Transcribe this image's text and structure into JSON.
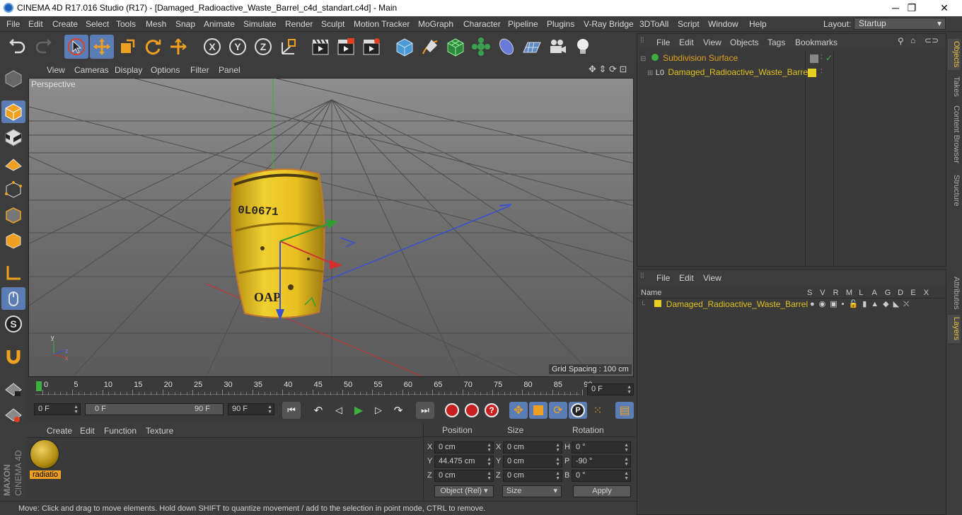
{
  "window": {
    "title": "CINEMA 4D R17.016 Studio (R17) - [Damaged_Radioactive_Waste_Barrel_c4d_standart.c4d] - Main",
    "minimize": "─",
    "maximize": "❐",
    "close": "✕"
  },
  "menubar": {
    "items": [
      "File",
      "Edit",
      "Create",
      "Select",
      "Tools",
      "Mesh",
      "Snap",
      "Animate",
      "Simulate",
      "Render",
      "Sculpt",
      "Motion Tracker",
      "MoGraph",
      "Character",
      "Pipeline",
      "Plugins",
      "V-Ray Bridge",
      "3DToAll",
      "Script",
      "Window",
      "Help"
    ],
    "layout_label": "Layout:",
    "layout_value": "Startup"
  },
  "viewport": {
    "menu": [
      "View",
      "Cameras",
      "Display",
      "Options",
      "Filter",
      "Panel"
    ],
    "name": "Perspective",
    "grid_spacing": "Grid Spacing : 100 cm",
    "barrel_text_top": "0L0671",
    "barrel_text_bottom": "OAP",
    "axis_x": "x",
    "axis_y": "y",
    "axis_z": "z"
  },
  "timeline": {
    "ticks": [
      "0",
      "5",
      "10",
      "15",
      "20",
      "25",
      "30",
      "35",
      "40",
      "45",
      "50",
      "55",
      "60",
      "65",
      "70",
      "75",
      "80",
      "85",
      "90"
    ],
    "current_frame": "0 F"
  },
  "transport": {
    "start": "0 F",
    "range_start": "0 F",
    "range_end": "90 F",
    "end": "90 F"
  },
  "material_panel": {
    "menu": [
      "Create",
      "Edit",
      "Function",
      "Texture"
    ],
    "material_name": "radiatio"
  },
  "coord_panel": {
    "headers": {
      "position": "Position",
      "size": "Size",
      "rotation": "Rotation"
    },
    "rows": [
      {
        "axis": "X",
        "pos": "0 cm",
        "size_axis": "X",
        "size": "0 cm",
        "rot_axis": "H",
        "rot": "0 °"
      },
      {
        "axis": "Y",
        "pos": "44.475 cm",
        "size_axis": "Y",
        "size": "0 cm",
        "rot_axis": "P",
        "rot": "-90 °"
      },
      {
        "axis": "Z",
        "pos": "0 cm",
        "size_axis": "Z",
        "size": "0 cm",
        "rot_axis": "B",
        "rot": "0 °"
      }
    ],
    "mode_select": "Object (Rel)",
    "size_select": "Size",
    "apply": "Apply"
  },
  "object_manager": {
    "menu": [
      "File",
      "Edit",
      "View",
      "Objects",
      "Tags",
      "Bookmarks"
    ],
    "objects": [
      {
        "name": "Subdivision Surface"
      },
      {
        "name": "Damaged_Radioactive_Waste_Barrel"
      }
    ]
  },
  "layer_manager": {
    "menu": [
      "File",
      "Edit",
      "View"
    ],
    "col_name": "Name",
    "columns": [
      "S",
      "V",
      "R",
      "M",
      "L",
      "A",
      "G",
      "D",
      "E",
      "X"
    ],
    "layer": "Damaged_Radioactive_Waste_Barrel"
  },
  "side_tabs": [
    "Objects",
    "Takes",
    "Content Browser",
    "Structure",
    "Attributes",
    "Layers"
  ],
  "status": "Move: Click and drag to move elements. Hold down SHIFT to quantize movement / add to the selection in point mode, CTRL to remove.",
  "brand": {
    "line1": "MAXON",
    "line2": "CINEMA 4D"
  },
  "colors": {
    "accent": "#5b7db5",
    "object_orange": "#e0a020",
    "layer_yellow": "#e8d020",
    "barrel": "#e8c020"
  }
}
